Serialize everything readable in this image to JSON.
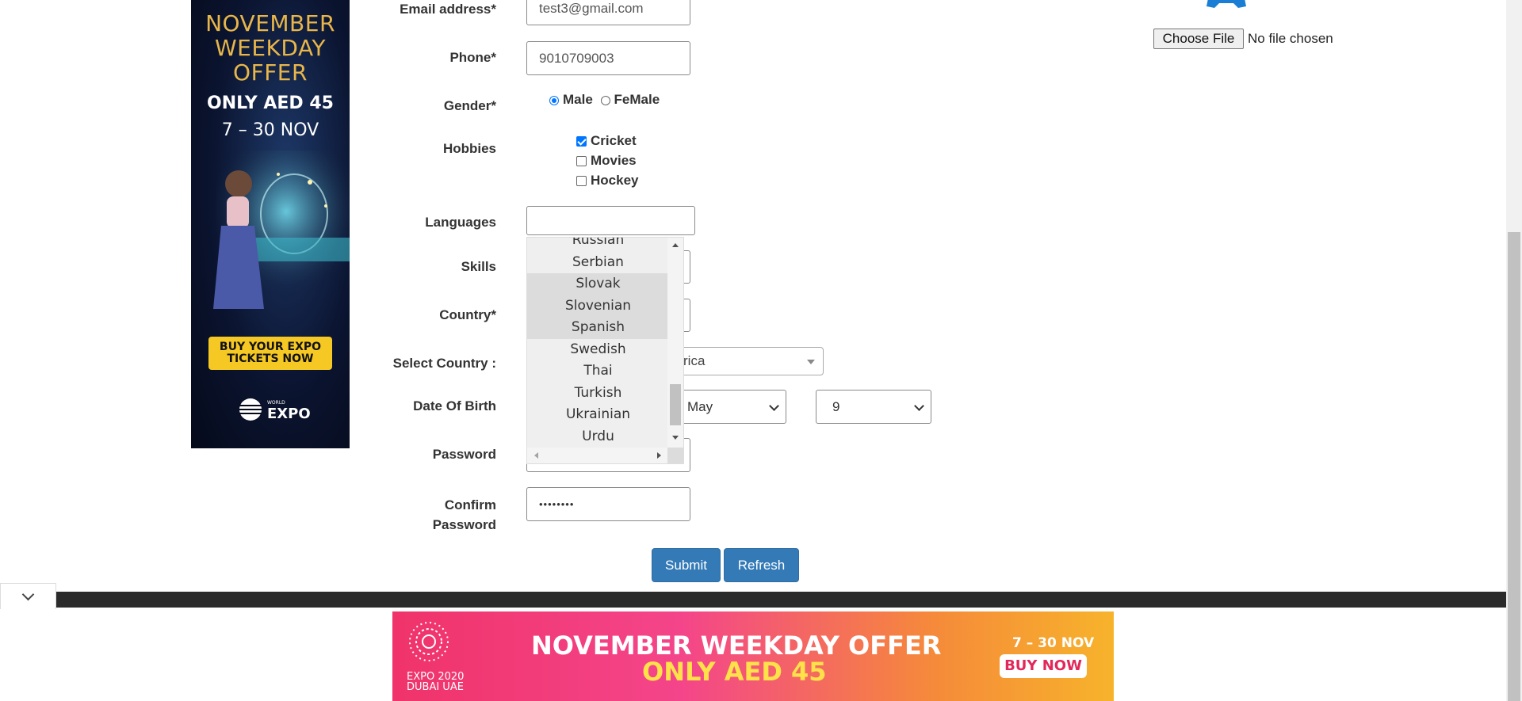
{
  "form": {
    "email": {
      "label": "Email address*",
      "value": "test3@gmail.com"
    },
    "phone": {
      "label": "Phone*",
      "value": "9010709003"
    },
    "gender": {
      "label": "Gender*",
      "options": [
        "Male",
        "FeMale"
      ],
      "selected": "Male"
    },
    "hobbies": {
      "label": "Hobbies",
      "options": [
        "Cricket",
        "Movies",
        "Hockey"
      ],
      "checked": [
        "Cricket"
      ]
    },
    "languages": {
      "label": "Languages",
      "value": "",
      "list": [
        "Russian",
        "Serbian",
        "Slovak",
        "Slovenian",
        "Spanish",
        "Swedish",
        "Thai",
        "Turkish",
        "Ukrainian",
        "Urdu"
      ],
      "highlighted": [
        "Slovak",
        "Slovenian",
        "Spanish"
      ]
    },
    "skills": {
      "label": "Skills"
    },
    "country": {
      "label": "Country*"
    },
    "select_country": {
      "label": "Select Country :",
      "value_visible": "rica"
    },
    "dob": {
      "label": "Date Of Birth",
      "month": "May",
      "day": "9"
    },
    "password": {
      "label": "Password"
    },
    "confirm_password": {
      "label_line1": "Confirm",
      "label_line2": "Password",
      "value": "••••••••"
    },
    "buttons": {
      "submit": "Submit",
      "refresh": "Refresh"
    }
  },
  "file_input": {
    "button": "Choose File",
    "status": "No file chosen"
  },
  "ads": {
    "vertical": {
      "title_lines": [
        "NOVEMBER",
        "WEEKDAY",
        "OFFER"
      ],
      "price": "ONLY AED 45",
      "dates": "7 – 30 NOV",
      "cta_lines": [
        "BUY YOUR EXPO",
        "TICKETS NOW"
      ],
      "logo_small": "WORLD",
      "logo": "EXPO"
    },
    "bottom": {
      "line1": "NOVEMBER WEEKDAY OFFER",
      "line2": "ONLY AED 45",
      "dates": "7 – 30 NOV",
      "cta": "BUY NOW",
      "logo_lines": [
        "EXPO 2020",
        "DUBAI UAE"
      ]
    }
  },
  "colors": {
    "primary_button": "#337ab7",
    "checkbox_accent": "#0075ff",
    "footer_bar": "#2b2b2b"
  }
}
